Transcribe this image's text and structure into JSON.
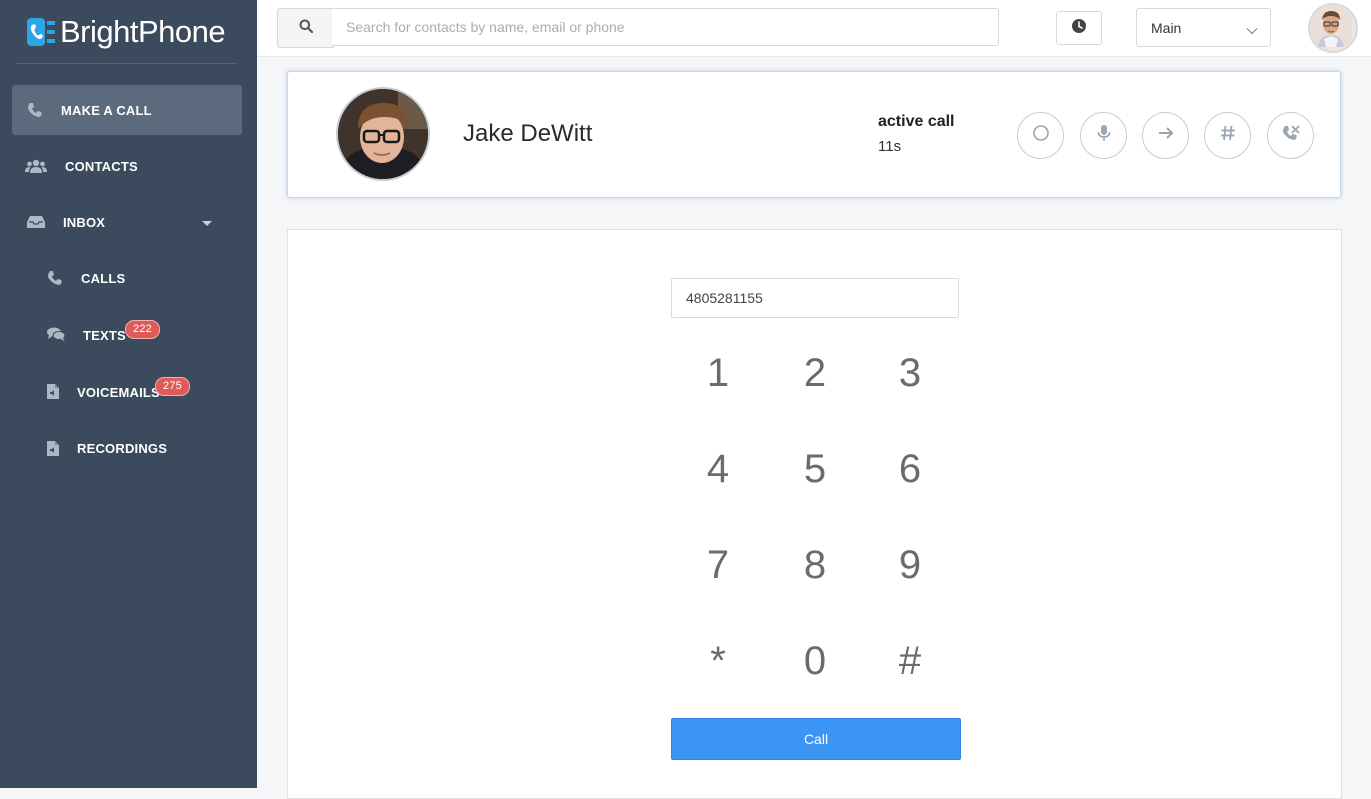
{
  "app": {
    "name": "BrightPhone"
  },
  "sidebar": {
    "items": [
      {
        "label": "MAKE A CALL",
        "icon": "phone-icon",
        "active": true
      },
      {
        "label": "CONTACTS",
        "icon": "users-icon"
      },
      {
        "label": "INBOX",
        "icon": "inbox-icon"
      },
      {
        "label": "CALLS",
        "icon": "phone-icon"
      },
      {
        "label": "TEXTS",
        "icon": "chat-icon",
        "badge": "222"
      },
      {
        "label": "VOICEMAILS",
        "icon": "audio-file-icon",
        "badge": "275"
      },
      {
        "label": "RECORDINGS",
        "icon": "audio-file-icon"
      }
    ]
  },
  "header": {
    "search_placeholder": "Search for contacts by name, email or phone",
    "line_select": "Main",
    "search_icon": "search-icon",
    "history_icon": "clock-icon"
  },
  "active_call": {
    "name": "Jake DeWitt",
    "status": "active call",
    "duration": "11s",
    "actions": [
      "record-icon",
      "microphone-icon",
      "transfer-icon",
      "keypad-icon",
      "hangup-icon"
    ]
  },
  "dialer": {
    "number": "4805281155",
    "keys": [
      "1",
      "2",
      "3",
      "4",
      "5",
      "6",
      "7",
      "8",
      "9",
      "*",
      "0",
      "#"
    ],
    "call_label": "Call"
  },
  "colors": {
    "sidebar_bg": "#3b4a5c",
    "active_item": "#5c6a7d",
    "badge": "#e05a5a",
    "primary": "#3a95f4"
  }
}
